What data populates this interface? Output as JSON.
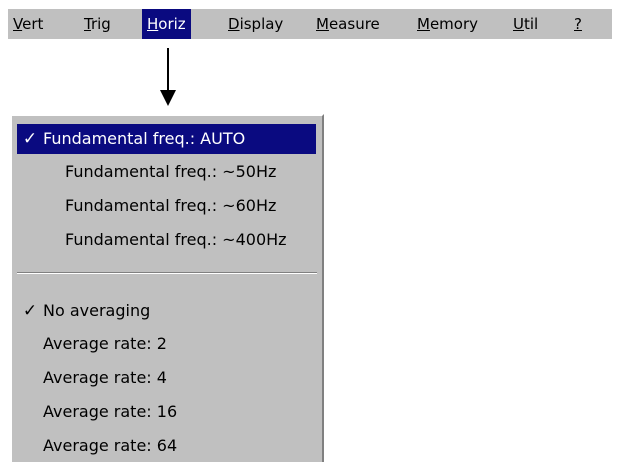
{
  "menubar": {
    "items": [
      {
        "mnemonic": "V",
        "rest": "ert"
      },
      {
        "mnemonic": "T",
        "rest": "rig"
      },
      {
        "mnemonic": "H",
        "rest": "oriz"
      },
      {
        "mnemonic": "D",
        "rest": "isplay"
      },
      {
        "mnemonic": "M",
        "rest": "easure"
      },
      {
        "mnemonic": "M",
        "rest": "emory"
      },
      {
        "mnemonic": "U",
        "rest": "til"
      },
      {
        "mnemonic": "?",
        "rest": ""
      }
    ],
    "active_item": "Horiz"
  },
  "dropdown": {
    "fundamental_group": [
      {
        "label": "Fundamental freq.: AUTO",
        "checked": true,
        "selected": true
      },
      {
        "label": "Fundamental freq.: ~50Hz",
        "checked": false,
        "selected": false
      },
      {
        "label": "Fundamental freq.: ~60Hz",
        "checked": false,
        "selected": false
      },
      {
        "label": "Fundamental freq.: ~400Hz",
        "checked": false,
        "selected": false
      }
    ],
    "averaging_group": [
      {
        "label": "No averaging",
        "checked": true,
        "selected": false
      },
      {
        "label": "Average rate: 2",
        "checked": false,
        "selected": false
      },
      {
        "label": "Average rate: 4",
        "checked": false,
        "selected": false
      },
      {
        "label": "Average rate: 16",
        "checked": false,
        "selected": false
      },
      {
        "label": "Average rate: 64",
        "checked": false,
        "selected": false
      }
    ],
    "check_glyph": "✓"
  },
  "colors": {
    "menu_background": "#c0c0c0",
    "highlight": "#0a0a80",
    "highlight_text": "#ffffff"
  },
  "icons": {
    "arrow": "down-arrow-icon",
    "check": "checkmark-icon"
  }
}
